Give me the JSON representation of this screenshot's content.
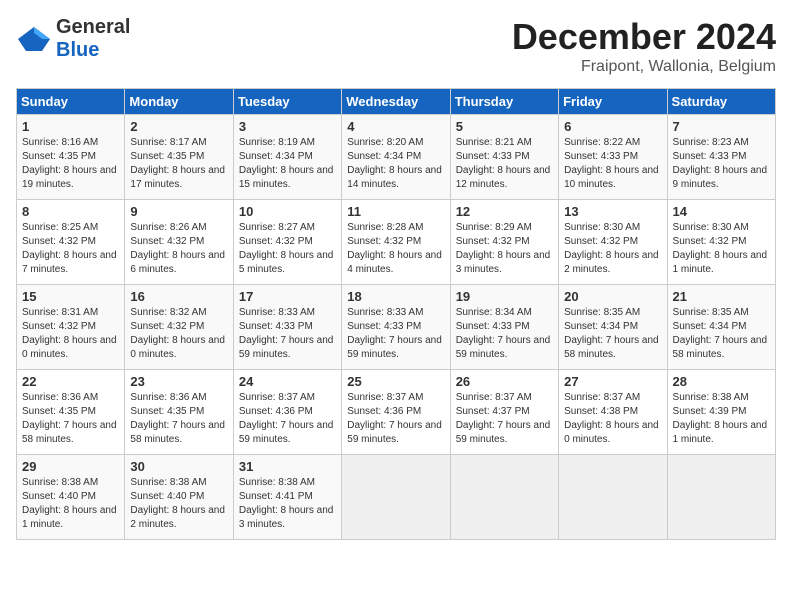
{
  "header": {
    "logo_general": "General",
    "logo_blue": "Blue",
    "month": "December 2024",
    "location": "Fraipont, Wallonia, Belgium"
  },
  "weekdays": [
    "Sunday",
    "Monday",
    "Tuesday",
    "Wednesday",
    "Thursday",
    "Friday",
    "Saturday"
  ],
  "weeks": [
    [
      {
        "day": "1",
        "sunrise": "Sunrise: 8:16 AM",
        "sunset": "Sunset: 4:35 PM",
        "daylight": "Daylight: 8 hours and 19 minutes."
      },
      {
        "day": "2",
        "sunrise": "Sunrise: 8:17 AM",
        "sunset": "Sunset: 4:35 PM",
        "daylight": "Daylight: 8 hours and 17 minutes."
      },
      {
        "day": "3",
        "sunrise": "Sunrise: 8:19 AM",
        "sunset": "Sunset: 4:34 PM",
        "daylight": "Daylight: 8 hours and 15 minutes."
      },
      {
        "day": "4",
        "sunrise": "Sunrise: 8:20 AM",
        "sunset": "Sunset: 4:34 PM",
        "daylight": "Daylight: 8 hours and 14 minutes."
      },
      {
        "day": "5",
        "sunrise": "Sunrise: 8:21 AM",
        "sunset": "Sunset: 4:33 PM",
        "daylight": "Daylight: 8 hours and 12 minutes."
      },
      {
        "day": "6",
        "sunrise": "Sunrise: 8:22 AM",
        "sunset": "Sunset: 4:33 PM",
        "daylight": "Daylight: 8 hours and 10 minutes."
      },
      {
        "day": "7",
        "sunrise": "Sunrise: 8:23 AM",
        "sunset": "Sunset: 4:33 PM",
        "daylight": "Daylight: 8 hours and 9 minutes."
      }
    ],
    [
      {
        "day": "8",
        "sunrise": "Sunrise: 8:25 AM",
        "sunset": "Sunset: 4:32 PM",
        "daylight": "Daylight: 8 hours and 7 minutes."
      },
      {
        "day": "9",
        "sunrise": "Sunrise: 8:26 AM",
        "sunset": "Sunset: 4:32 PM",
        "daylight": "Daylight: 8 hours and 6 minutes."
      },
      {
        "day": "10",
        "sunrise": "Sunrise: 8:27 AM",
        "sunset": "Sunset: 4:32 PM",
        "daylight": "Daylight: 8 hours and 5 minutes."
      },
      {
        "day": "11",
        "sunrise": "Sunrise: 8:28 AM",
        "sunset": "Sunset: 4:32 PM",
        "daylight": "Daylight: 8 hours and 4 minutes."
      },
      {
        "day": "12",
        "sunrise": "Sunrise: 8:29 AM",
        "sunset": "Sunset: 4:32 PM",
        "daylight": "Daylight: 8 hours and 3 minutes."
      },
      {
        "day": "13",
        "sunrise": "Sunrise: 8:30 AM",
        "sunset": "Sunset: 4:32 PM",
        "daylight": "Daylight: 8 hours and 2 minutes."
      },
      {
        "day": "14",
        "sunrise": "Sunrise: 8:30 AM",
        "sunset": "Sunset: 4:32 PM",
        "daylight": "Daylight: 8 hours and 1 minute."
      }
    ],
    [
      {
        "day": "15",
        "sunrise": "Sunrise: 8:31 AM",
        "sunset": "Sunset: 4:32 PM",
        "daylight": "Daylight: 8 hours and 0 minutes."
      },
      {
        "day": "16",
        "sunrise": "Sunrise: 8:32 AM",
        "sunset": "Sunset: 4:32 PM",
        "daylight": "Daylight: 8 hours and 0 minutes."
      },
      {
        "day": "17",
        "sunrise": "Sunrise: 8:33 AM",
        "sunset": "Sunset: 4:33 PM",
        "daylight": "Daylight: 7 hours and 59 minutes."
      },
      {
        "day": "18",
        "sunrise": "Sunrise: 8:33 AM",
        "sunset": "Sunset: 4:33 PM",
        "daylight": "Daylight: 7 hours and 59 minutes."
      },
      {
        "day": "19",
        "sunrise": "Sunrise: 8:34 AM",
        "sunset": "Sunset: 4:33 PM",
        "daylight": "Daylight: 7 hours and 59 minutes."
      },
      {
        "day": "20",
        "sunrise": "Sunrise: 8:35 AM",
        "sunset": "Sunset: 4:34 PM",
        "daylight": "Daylight: 7 hours and 58 minutes."
      },
      {
        "day": "21",
        "sunrise": "Sunrise: 8:35 AM",
        "sunset": "Sunset: 4:34 PM",
        "daylight": "Daylight: 7 hours and 58 minutes."
      }
    ],
    [
      {
        "day": "22",
        "sunrise": "Sunrise: 8:36 AM",
        "sunset": "Sunset: 4:35 PM",
        "daylight": "Daylight: 7 hours and 58 minutes."
      },
      {
        "day": "23",
        "sunrise": "Sunrise: 8:36 AM",
        "sunset": "Sunset: 4:35 PM",
        "daylight": "Daylight: 7 hours and 58 minutes."
      },
      {
        "day": "24",
        "sunrise": "Sunrise: 8:37 AM",
        "sunset": "Sunset: 4:36 PM",
        "daylight": "Daylight: 7 hours and 59 minutes."
      },
      {
        "day": "25",
        "sunrise": "Sunrise: 8:37 AM",
        "sunset": "Sunset: 4:36 PM",
        "daylight": "Daylight: 7 hours and 59 minutes."
      },
      {
        "day": "26",
        "sunrise": "Sunrise: 8:37 AM",
        "sunset": "Sunset: 4:37 PM",
        "daylight": "Daylight: 7 hours and 59 minutes."
      },
      {
        "day": "27",
        "sunrise": "Sunrise: 8:37 AM",
        "sunset": "Sunset: 4:38 PM",
        "daylight": "Daylight: 8 hours and 0 minutes."
      },
      {
        "day": "28",
        "sunrise": "Sunrise: 8:38 AM",
        "sunset": "Sunset: 4:39 PM",
        "daylight": "Daylight: 8 hours and 1 minute."
      }
    ],
    [
      {
        "day": "29",
        "sunrise": "Sunrise: 8:38 AM",
        "sunset": "Sunset: 4:40 PM",
        "daylight": "Daylight: 8 hours and 1 minute."
      },
      {
        "day": "30",
        "sunrise": "Sunrise: 8:38 AM",
        "sunset": "Sunset: 4:40 PM",
        "daylight": "Daylight: 8 hours and 2 minutes."
      },
      {
        "day": "31",
        "sunrise": "Sunrise: 8:38 AM",
        "sunset": "Sunset: 4:41 PM",
        "daylight": "Daylight: 8 hours and 3 minutes."
      },
      null,
      null,
      null,
      null
    ]
  ]
}
